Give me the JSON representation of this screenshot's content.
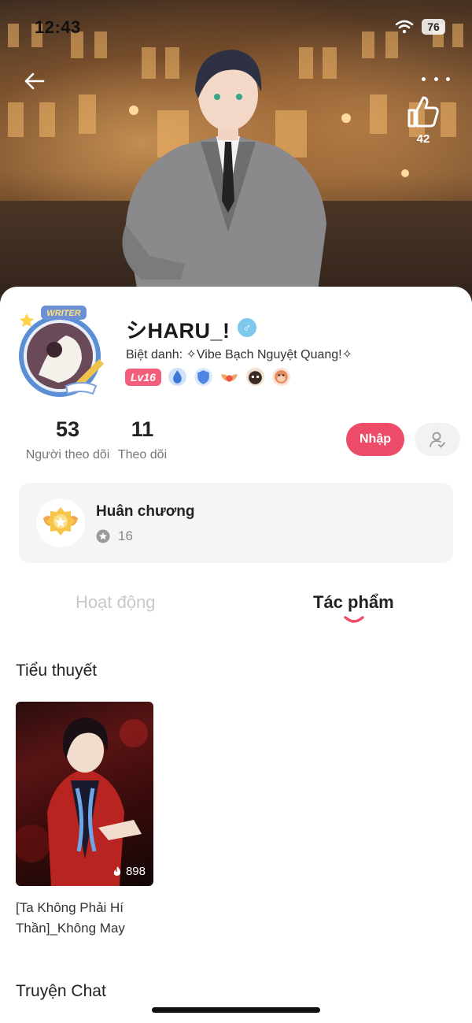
{
  "status_bar": {
    "time": "12:43",
    "battery": "76",
    "wifi_icon": "wifi-icon"
  },
  "header": {
    "back_icon": "arrow-left-icon",
    "more_icon": "more-dots-icon",
    "like_icon": "thumbs-up-icon",
    "like_count": "42"
  },
  "profile": {
    "avatar_frame_label": "WRITER",
    "username": "シHARU_!",
    "gender_symbol": "♂",
    "nickname": "Biệt danh: ✧Vibe Bạch Nguyệt Quang!✧",
    "level": "Lv16",
    "badge_icons": [
      "droplet-badge-icon",
      "shield-badge-icon",
      "wings-badge-icon",
      "dark-face-badge-icon",
      "monkey-badge-icon"
    ]
  },
  "stats": {
    "followers_count": "53",
    "followers_label": "Người theo dõi",
    "following_count": "11",
    "following_label": "Theo dõi"
  },
  "actions": {
    "import_label": "Nhập",
    "person_icon": "person-check-icon"
  },
  "medals": {
    "title": "Huân chương",
    "count": "16"
  },
  "tabs": [
    {
      "label": "Hoạt động",
      "active": false
    },
    {
      "label": "Tác phẩm",
      "active": true
    }
  ],
  "sections": {
    "novels_title": "Tiểu thuyết",
    "chat_title": "Truyện Chat"
  },
  "books": [
    {
      "title": "[Ta Không Phải Hí Thần]_Không May",
      "views": "898"
    }
  ],
  "colors": {
    "accent": "#ec4c67",
    "level_badge": "#f35f7b",
    "gender_badge": "#7ec8ee"
  }
}
